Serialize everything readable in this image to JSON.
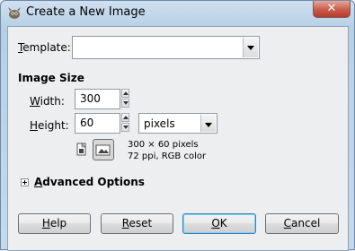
{
  "window": {
    "title": "Create a New Image"
  },
  "template": {
    "label_prefix": "",
    "label_accel": "T",
    "label_rest": "emplate:",
    "value": ""
  },
  "image_size": {
    "heading": "Image Size",
    "width_accel": "W",
    "width_rest": "idth:",
    "width_value": "300",
    "height_accel": "H",
    "height_rest": "eight:",
    "height_value": "60",
    "unit": "pixels",
    "info_line1": "300 × 60 pixels",
    "info_line2": "72 ppi, RGB color"
  },
  "advanced": {
    "accel": "A",
    "rest": "dvanced Options"
  },
  "buttons": {
    "help_accel": "H",
    "help_rest": "elp",
    "reset_accel": "R",
    "reset_rest": "eset",
    "ok_accel": "O",
    "ok_rest": "K",
    "cancel_accel": "C",
    "cancel_rest": "ancel"
  }
}
